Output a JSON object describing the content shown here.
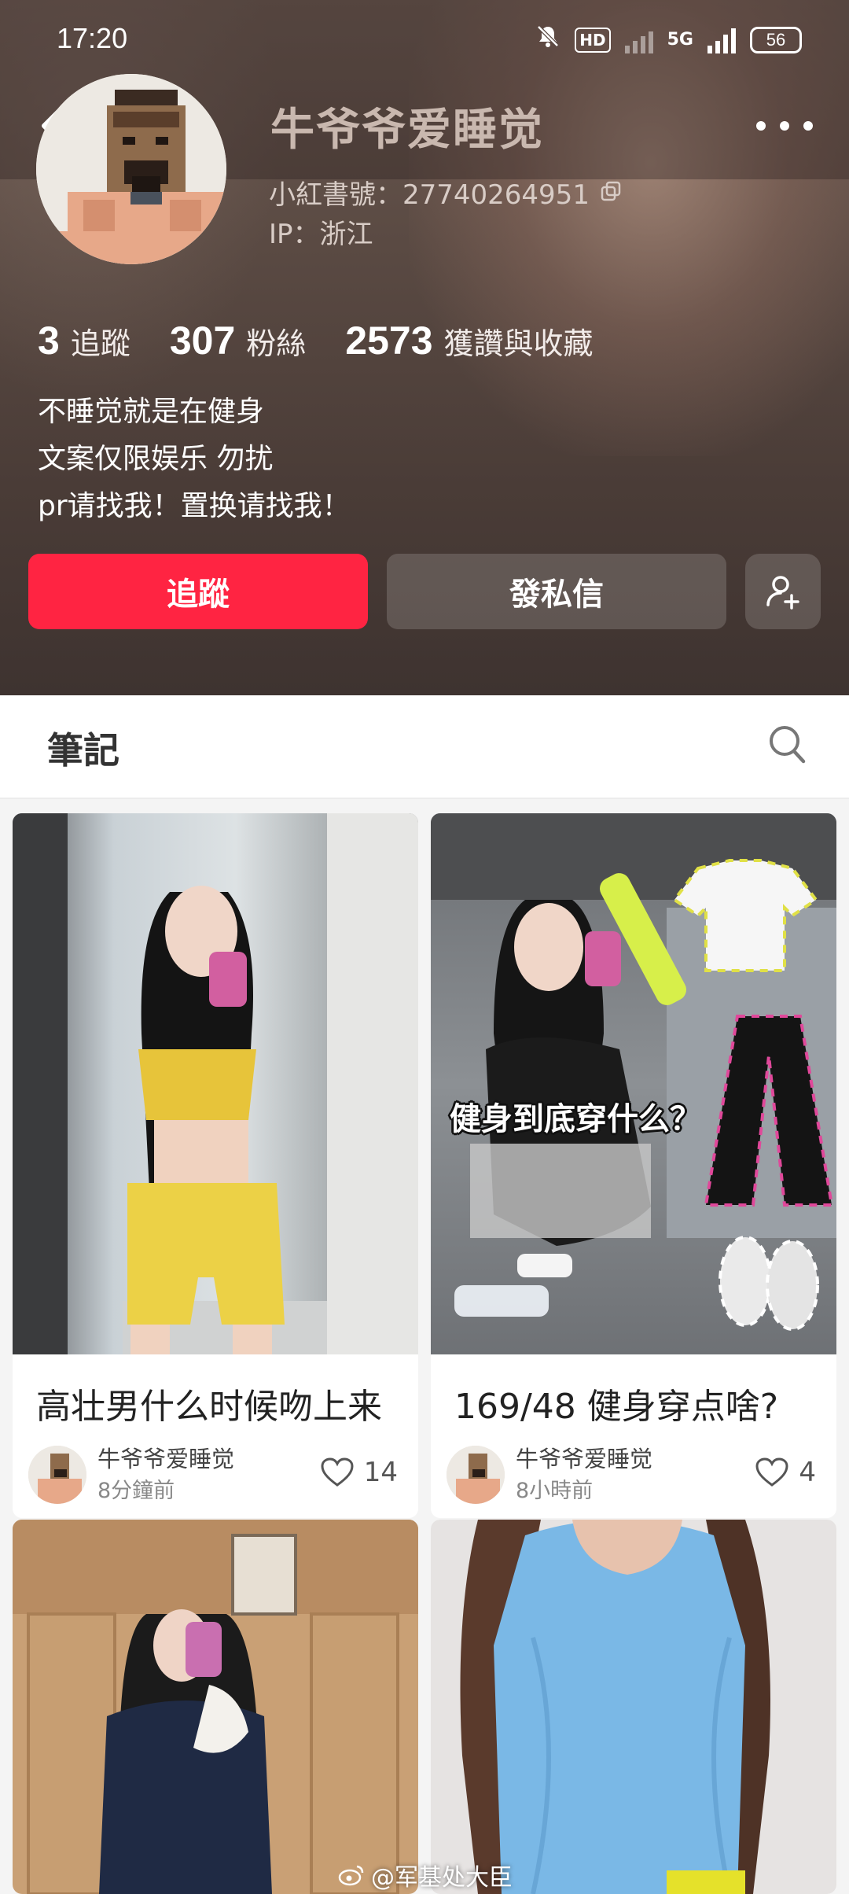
{
  "status": {
    "time": "17:20",
    "hd_label": "HD",
    "network": "5G",
    "battery": "56"
  },
  "profile": {
    "nickname": "牛爷爷爱睡觉",
    "red_id": "小紅書號：27740264951",
    "ip": "IP：浙江",
    "stats": [
      {
        "num": "3",
        "label": "追蹤"
      },
      {
        "num": "307",
        "label": "粉絲"
      },
      {
        "num": "2573",
        "label": "獲讚與收藏"
      }
    ],
    "bio": [
      "不睡觉就是在健身",
      "文案仅限娱乐 勿扰",
      "pr请找我！置换请找我！"
    ],
    "follow_label": "追蹤",
    "message_label": "發私信"
  },
  "tabs": {
    "notes_label": "筆記"
  },
  "posts": [
    {
      "title": "高壮男什么时候吻上来",
      "author": "牛爷爷爱睡觉",
      "ago": "8分鐘前",
      "likes": "14"
    },
    {
      "title": "169/48 健身穿点啥?",
      "author": "牛爷爷爱睡觉",
      "ago": "8小時前",
      "likes": "4",
      "overlay": "健身到底穿什么？"
    },
    {
      "title": "",
      "author": "",
      "ago": "",
      "likes": ""
    },
    {
      "title": "",
      "author": "",
      "ago": "",
      "likes": ""
    }
  ],
  "watermark": "@军基处大臣",
  "colors": {
    "accent": "#ff2442",
    "header_bg": "#5a4a43"
  }
}
